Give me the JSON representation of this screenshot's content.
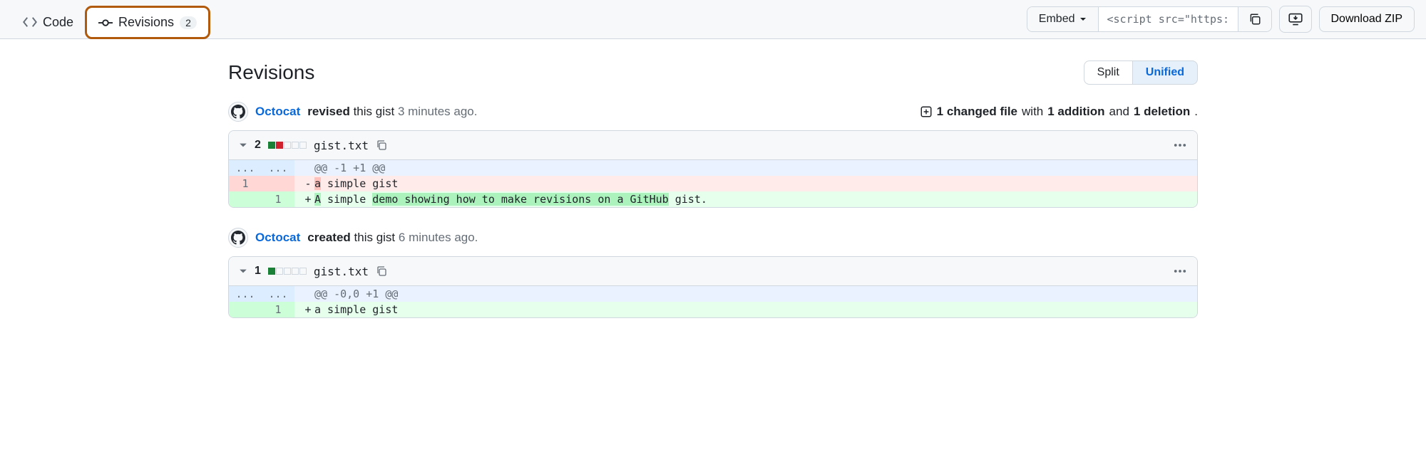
{
  "tabs": {
    "code": "Code",
    "revisions": "Revisions",
    "revisions_count": "2"
  },
  "toolbar": {
    "embed_label": "Embed",
    "embed_value": "<script src=\"https://",
    "download_label": "Download ZIP"
  },
  "page": {
    "title": "Revisions"
  },
  "diff_toggle": {
    "split": "Split",
    "unified": "Unified"
  },
  "revisions": [
    {
      "author": "Octocat",
      "action": "revised",
      "suffix": "this gist",
      "time": "3 minutes ago.",
      "stats": {
        "changed_files": "1 changed file",
        "with": "with",
        "additions": "1 addition",
        "and": "and",
        "deletions": "1 deletion",
        "dot": "."
      },
      "file": {
        "count": "2",
        "blocks": [
          "g",
          "r",
          "n",
          "n",
          "n"
        ],
        "filename": "gist.txt",
        "hunk": "@@ -1 +1 @@",
        "lines": [
          {
            "type": "del",
            "old": "1",
            "new": "",
            "marker": "-",
            "prefix": "",
            "hl": "a",
            "rest": " simple gist"
          },
          {
            "type": "add",
            "old": "",
            "new": "1",
            "marker": "+",
            "prefix": "",
            "hl": "A",
            "rest_pre": " simple ",
            "hl2": "demo showing how to make revisions on a GitHub",
            "rest": " gist."
          }
        ]
      }
    },
    {
      "author": "Octocat",
      "action": "created",
      "suffix": "this gist",
      "time": "6 minutes ago.",
      "stats": null,
      "file": {
        "count": "1",
        "blocks": [
          "g",
          "n",
          "n",
          "n",
          "n"
        ],
        "filename": "gist.txt",
        "hunk": "@@ -0,0 +1 @@",
        "lines": [
          {
            "type": "add",
            "old": "",
            "new": "1",
            "marker": "+",
            "prefix": "",
            "rest": "a simple gist"
          }
        ]
      }
    }
  ]
}
